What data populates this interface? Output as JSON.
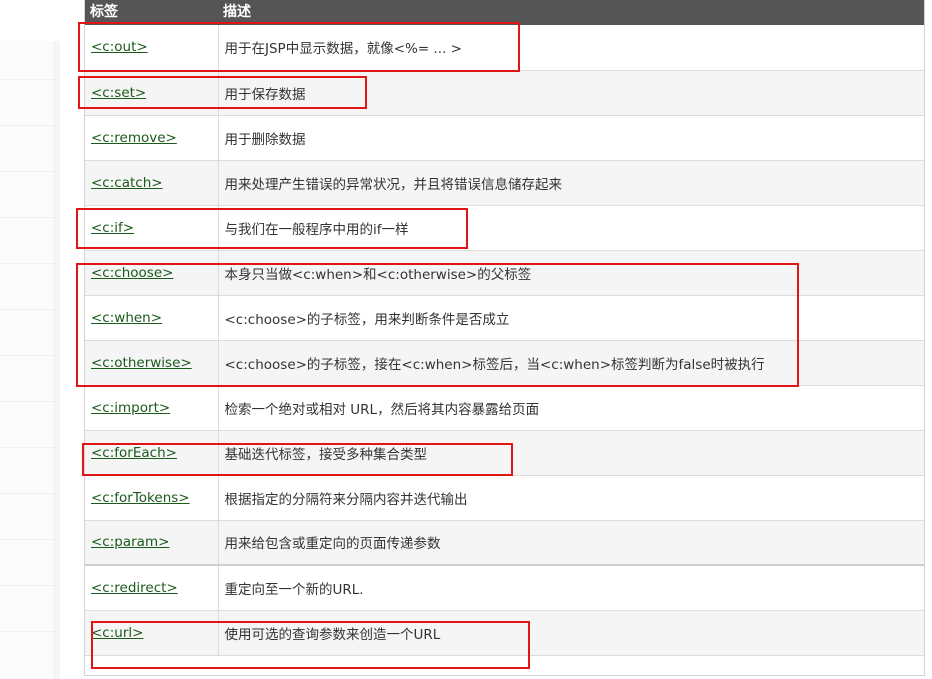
{
  "table": {
    "header": {
      "tag": "标签",
      "desc": "描述"
    },
    "rows": [
      {
        "tag": "<c:out>",
        "desc": "用于在JSP中显示数据，就像<%= ... >"
      },
      {
        "tag": "<c:set>",
        "desc": "用于保存数据"
      },
      {
        "tag": "<c:remove>",
        "desc": "用于删除数据"
      },
      {
        "tag": "<c:catch>",
        "desc": "用来处理产生错误的异常状况，并且将错误信息储存起来"
      },
      {
        "tag": "<c:if>",
        "desc": "与我们在一般程序中用的if一样"
      },
      {
        "tag": "<c:choose>",
        "desc": "本身只当做<c:when>和<c:otherwise>的父标签"
      },
      {
        "tag": "<c:when>",
        "desc": "<c:choose>的子标签，用来判断条件是否成立"
      },
      {
        "tag": "<c:otherwise>",
        "desc": "<c:choose>的子标签，接在<c:when>标签后，当<c:when>标签判断为false时被执行"
      },
      {
        "tag": "<c:import>",
        "desc": "检索一个绝对或相对 URL，然后将其内容暴露给页面"
      },
      {
        "tag": "<c:forEach>",
        "desc": "基础迭代标签，接受多种集合类型"
      },
      {
        "tag": "<c:forTokens>",
        "desc": "根据指定的分隔符来分隔内容并迭代输出"
      },
      {
        "tag": "<c:param>",
        "desc": "用来给包含或重定向的页面传递参数"
      },
      {
        "tag": "<c:redirect>",
        "desc": "重定向至一个新的URL."
      },
      {
        "tag": "<c:url>",
        "desc": "使用可选的查询参数来创造一个URL"
      }
    ]
  },
  "highlight_color": "#e01616",
  "link_color": "#1a5a1a",
  "header_bg": "#555555"
}
